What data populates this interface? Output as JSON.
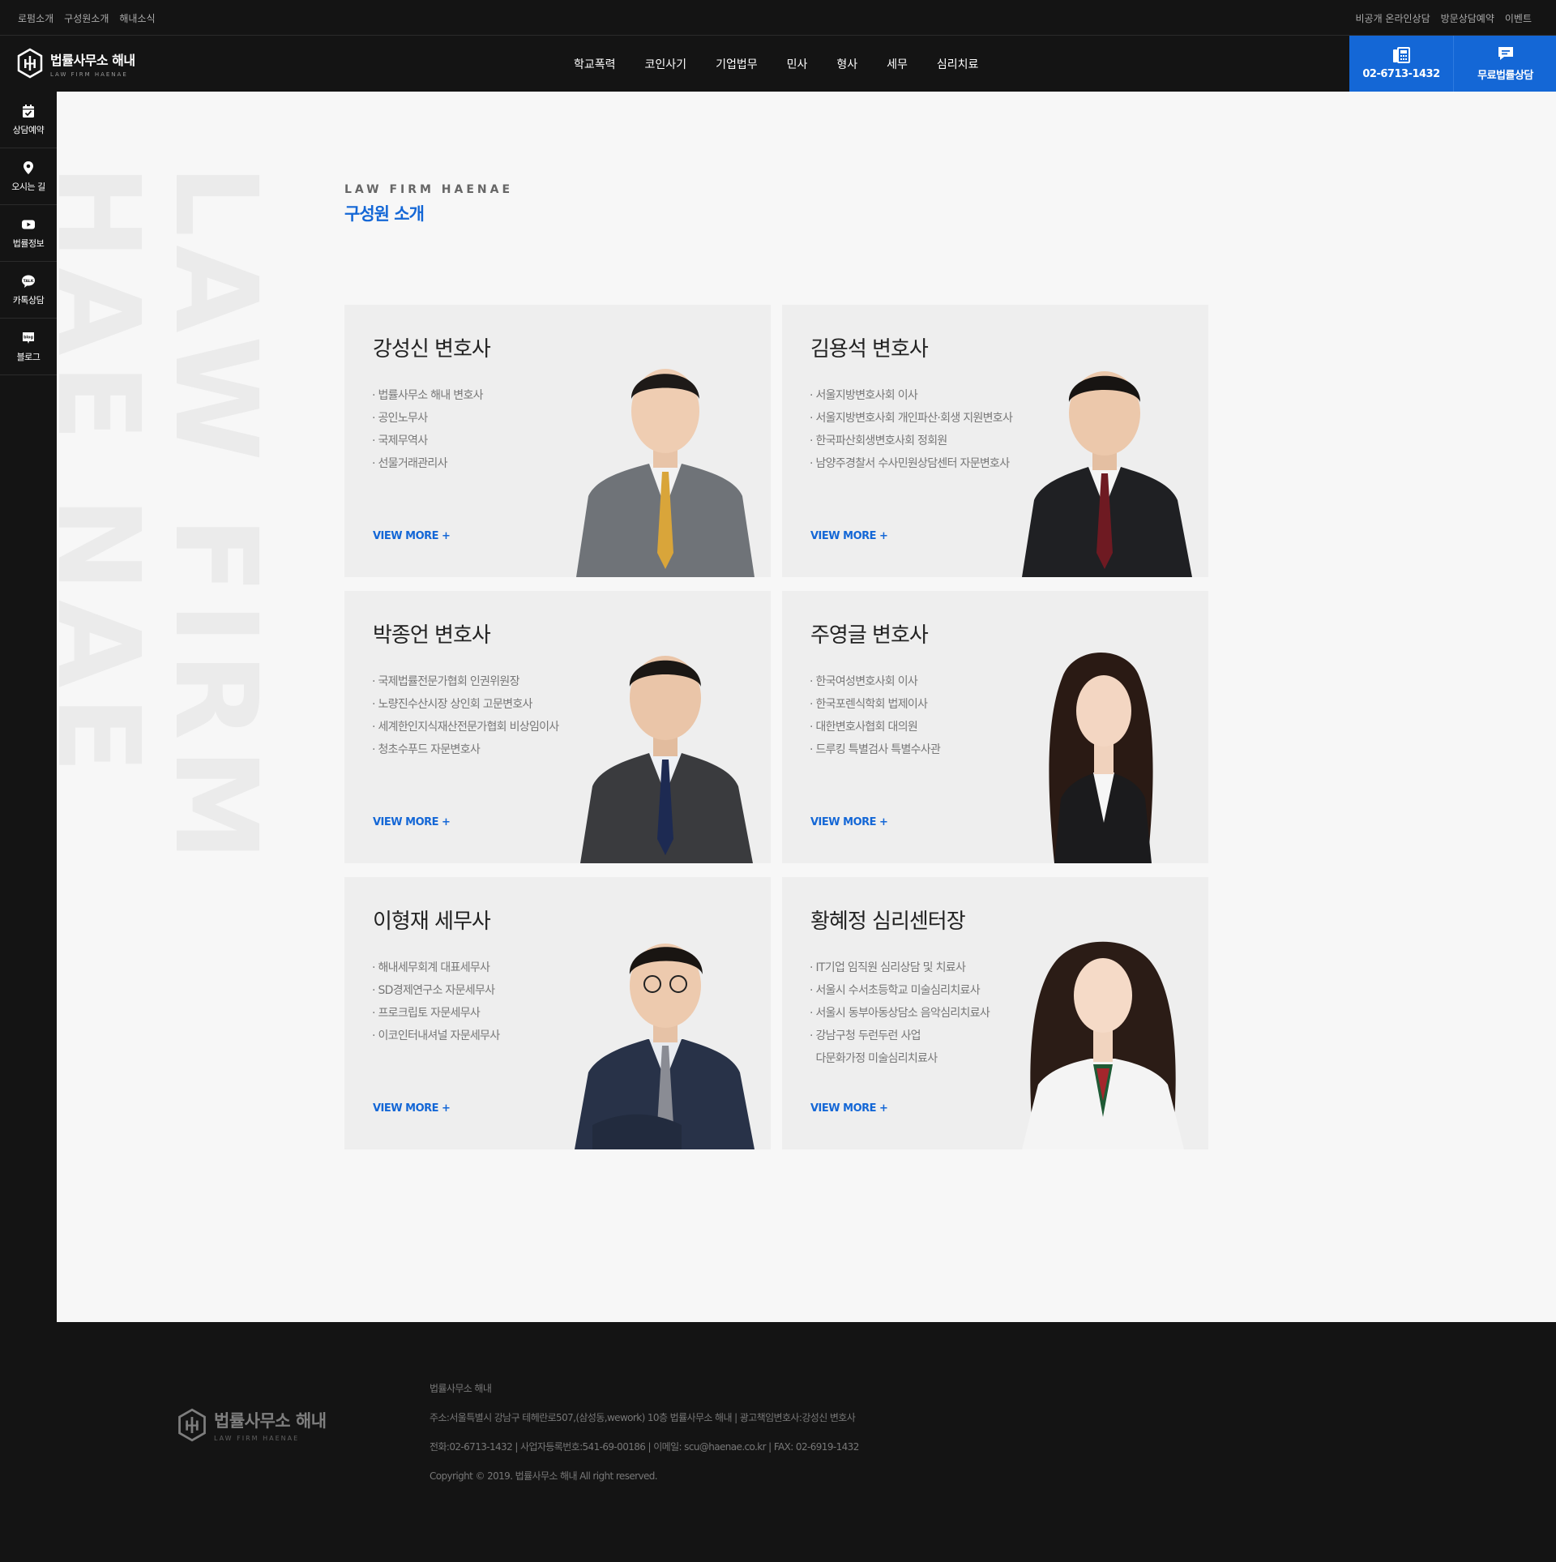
{
  "topbar": {
    "left_links": [
      "로펌소개",
      "구성원소개",
      "해내소식"
    ],
    "right_links": [
      "비공개 온라인상담",
      "방문상담예약",
      "이벤트"
    ]
  },
  "header": {
    "logo_ko": "법률사무소 해내",
    "logo_en": "LAW FIRM HAENAE",
    "nav": [
      "학교폭력",
      "코인사기",
      "기업법무",
      "민사",
      "형사",
      "세무",
      "심리치료"
    ],
    "cta_phone": "02-6713-1432",
    "cta_consult": "무료법률상담"
  },
  "sidebar": {
    "items": [
      {
        "label": "상담예약",
        "icon": "calendar-check-icon"
      },
      {
        "label": "오시는 길",
        "icon": "map-pin-icon"
      },
      {
        "label": "법률정보",
        "icon": "youtube-icon"
      },
      {
        "label": "카톡상담",
        "icon": "kakaotalk-icon"
      },
      {
        "label": "블로그",
        "icon": "blog-icon"
      }
    ]
  },
  "main": {
    "bg_text_1": "LAW FIRM",
    "bg_text_2": "HAE NAE",
    "eyebrow": "LAW FIRM HAENAE",
    "title": "구성원 소개",
    "view_more": "VIEW MORE +",
    "members": [
      {
        "name": "강성신 변호사",
        "items": [
          "· 법률사무소 해내 변호사",
          "· 공인노무사",
          "· 국제무역사",
          "· 선물거래관리사"
        ]
      },
      {
        "name": "김용석 변호사",
        "items": [
          "· 서울지방변호사회 이사",
          "· 서울지방변호사회 개인파산·회생 지원변호사",
          "· 한국파산회생변호사회 정회원",
          "· 남양주경찰서 수사민원상담센터 자문변호사"
        ]
      },
      {
        "name": "박종언 변호사",
        "items": [
          "· 국제법률전문가협회 인권위원장",
          "· 노량진수산시장 상인회 고문변호사",
          "· 세계한인지식재산전문가협회 비상임이사",
          "· 청초수푸드 자문변호사"
        ]
      },
      {
        "name": "주영글 변호사",
        "items": [
          "· 한국여성변호사회 이사",
          "· 한국포렌식학회 법제이사",
          "· 대한변호사협회 대의원",
          "· 드루킹 특별검사 특별수사관"
        ]
      },
      {
        "name": "이형재 세무사",
        "items": [
          "· 해내세무회계 대표세무사",
          "· SD경제연구소 자문세무사",
          "· 프로크립토 자문세무사",
          "· 이코인터내셔널 자문세무사"
        ]
      },
      {
        "name": "황혜정 심리센터장",
        "items": [
          "· IT기업 임직원 심리상담 및 치료사",
          "· 서울시 수서초등학교 미술심리치료사",
          "· 서울시 동부아동상담소 음악심리치료사",
          "· 강남구청 두런두런 사업",
          "  다문화가정 미술심리치료사"
        ]
      }
    ]
  },
  "footer": {
    "logo_ko": "법률사무소 해내",
    "logo_en": "LAW FIRM HAENAE",
    "lines": [
      "법률사무소 해내",
      "주소:서울특별시 강남구 테헤란로507,(삼성동,wework) 10층 법률사무소 해내 | 광고책임변호사:강성신 변호사",
      "전화:02-6713-1432 | 사업자등록번호:541-69-00186 | 이메일: scu@haenae.co.kr | FAX: 02-6919-1432",
      "Copyright © 2019. 법률사무소 해내 All right reserved."
    ]
  },
  "colors": {
    "accent": "#1467d6",
    "dark": "#141414",
    "page_bg": "#f7f7f7",
    "card_bg": "#eeeeee"
  }
}
